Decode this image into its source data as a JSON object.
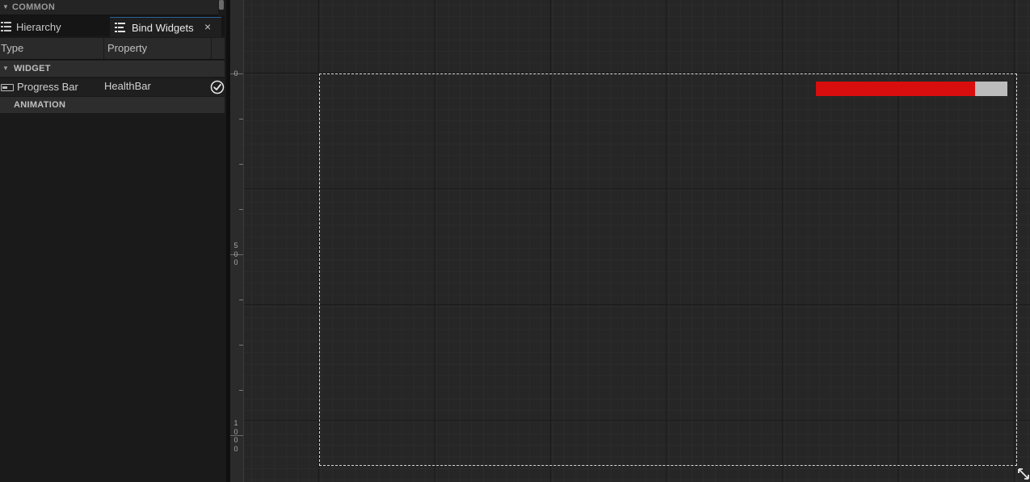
{
  "common_section": {
    "label": "COMMON"
  },
  "tabs": [
    {
      "label": "Hierarchy",
      "icon": "hierarchy-list-icon"
    },
    {
      "label": "Bind Widgets",
      "icon": "bind-list-icon",
      "active": true
    }
  ],
  "tab_close": "×",
  "columns": {
    "type": "Type",
    "property": "Property"
  },
  "sections": {
    "widget": "WIDGET",
    "animation": "ANIMATION"
  },
  "bindings": [
    {
      "type": "Progress Bar",
      "property": "HealthBar",
      "bound": true,
      "icon": "progress-bar-icon"
    }
  ],
  "ruler": {
    "labels": [
      "0",
      "500",
      "1000"
    ]
  },
  "canvas": {
    "progress_percent": 83,
    "fill_color": "#d80d0d",
    "track_color": "#bdbdbd"
  },
  "colors": {
    "accent_tab": "#2c5f93",
    "canvas_bg": "#262626",
    "panel_bg": "#1a1a1a"
  }
}
